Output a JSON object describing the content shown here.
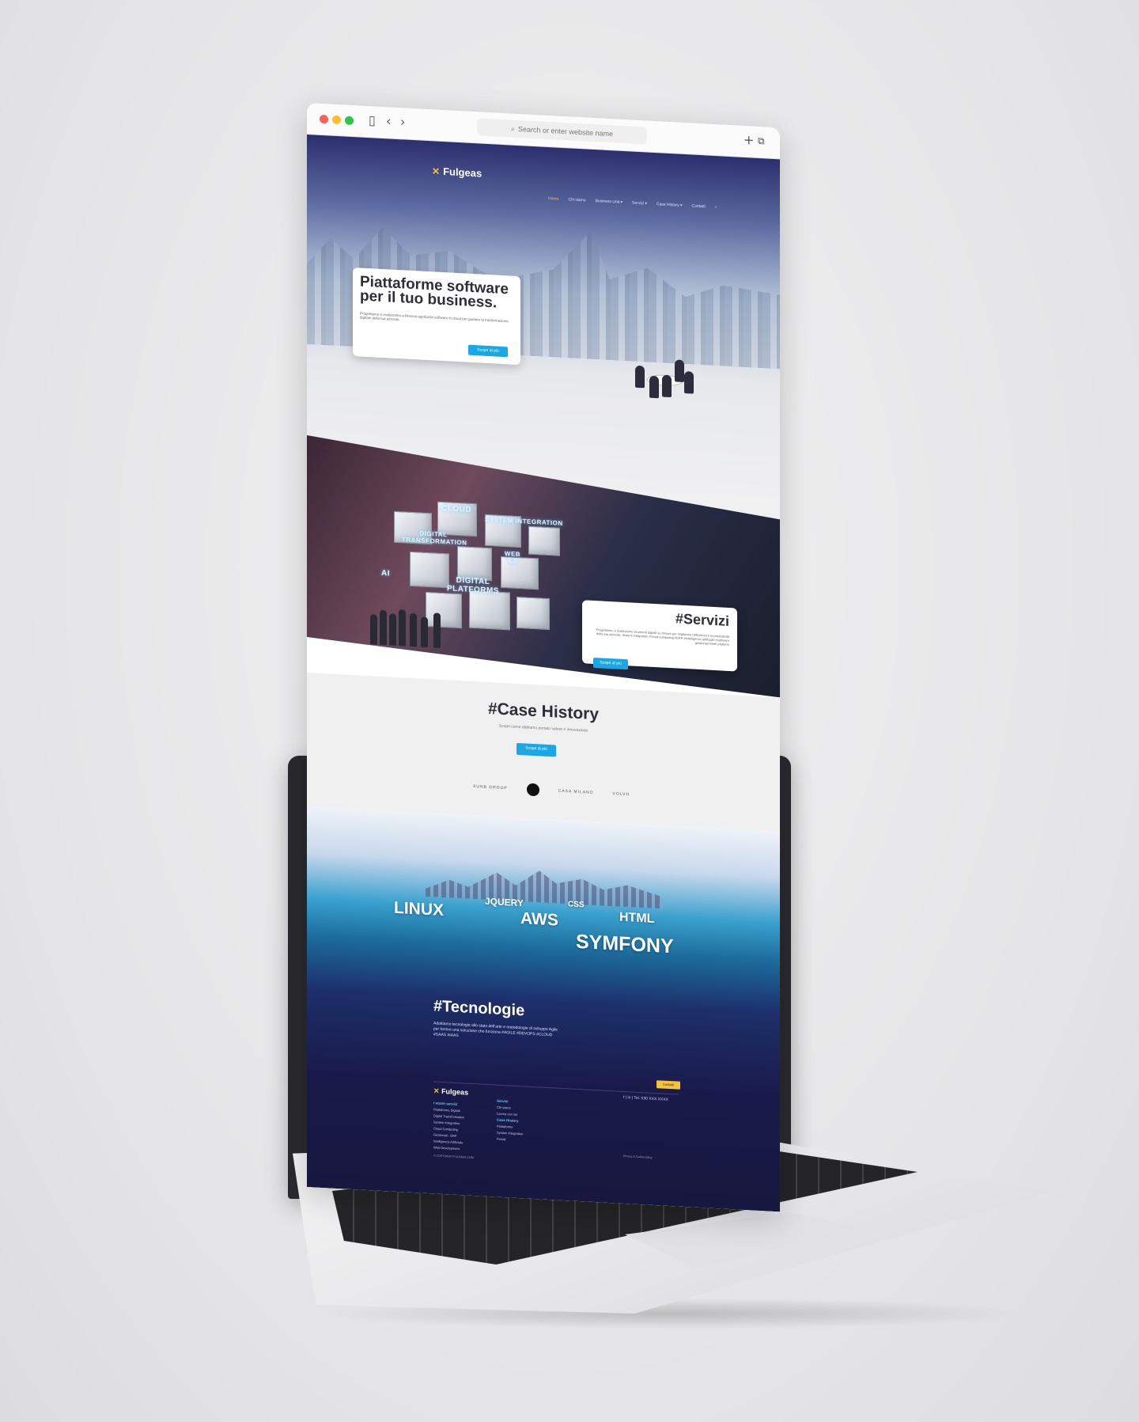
{
  "browser": {
    "address_placeholder": "Search or enter website name",
    "back_icon": "chevron-left-icon",
    "forward_icon": "chevron-right-icon"
  },
  "site": {
    "brand": "Fulgeas",
    "nav": [
      "Home",
      "Chi siamo",
      "Business Unit ▾",
      "Servizi ▾",
      "Case History ▾",
      "Contatti"
    ]
  },
  "hero": {
    "title": "Piattaforme software per il tuo business.",
    "text": "Progettiamo e realizziamo a Brescia applicativi software in cloud per guidare la trasformazione digitale della tua azienda.",
    "button": "Scopri di più"
  },
  "services": {
    "tags": [
      "CLOUD",
      "SYSTEM INTEGRATION",
      "DIGITAL TRANSFORMATION",
      "WEB 4.0",
      "AI",
      "DIGITAL PLATFORMS"
    ],
    "title": "#Servizi",
    "text": "Progettiamo e realizziamo strumenti digitali su misura per migliorare l'efficienza e la produttività della tua azienda. Sistemi integration #cloud computing #ERP #intelligenza artificiale #software gestionali #web platform",
    "button": "Scopri di più"
  },
  "case_history": {
    "title": "#Case History",
    "subtitle": "Scopri come abbiamo portato valore e innovazione",
    "button": "Scopri di più",
    "logos": [
      "SUNB GROUP",
      "CASA MILANO",
      "VOLVO"
    ]
  },
  "technologies": {
    "words": [
      "LINUX",
      "JQUERY",
      "AWS",
      "CSS",
      "HTML",
      "SYMFONY"
    ],
    "title": "#Tecnologie",
    "text": "Adottiamo tecnologie allo stato dell'arte e metodologie di sviluppo Agile per fornire una soluzione che funziona #AGILE #DEVOPS #CLOUD #SAAS #IAAS"
  },
  "footer": {
    "cta": "Contatti",
    "brand": "Fulgeas",
    "phone": "Tel. 030 XXX XXXX",
    "col1_title": "I nostri servizi",
    "col1": [
      "Piattaforme Digitali",
      "Digital Transformation",
      "System Integration",
      "Cloud Computing",
      "Gestionali - ERP",
      "Intelligenza Artificiale",
      "Web Development"
    ],
    "col2_title": "Servizi",
    "col2": [
      "Chi siamo",
      "Lavora con noi"
    ],
    "col3_title": "Case History",
    "col3": [
      "Piattaforme",
      "System Integration",
      "Portali"
    ],
    "legal": "© COPYRIGHT FULGEAS.COM",
    "legal2": "Privacy & Cookie policy"
  }
}
